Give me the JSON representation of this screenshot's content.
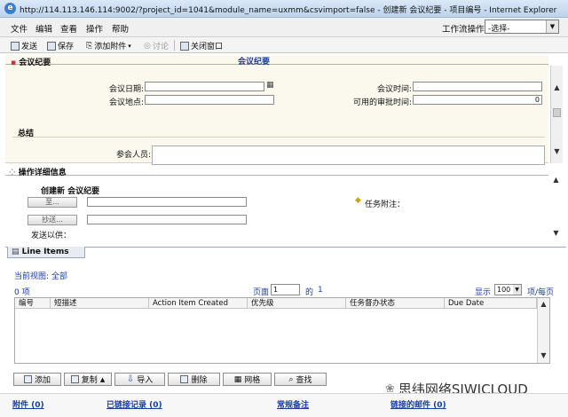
{
  "window": {
    "title": "http://114.113.146.114:9002/?project_id=1041&module_name=uxmm&csvimport=false - 创建新 会议纪要 - 项目编号 - Internet Explorer"
  },
  "menu": [
    "文件",
    "编辑",
    "查看",
    "操作",
    "帮助"
  ],
  "workflow": {
    "label": "工作流操作",
    "selected": "-选择-"
  },
  "toolbar": {
    "send": "发送",
    "save": "保存",
    "attach": "添加附件",
    "discuss": "讨论",
    "close": "关闭窗口"
  },
  "meeting": {
    "section_label": "会议纪要",
    "tab_title": "会议纪要",
    "date_label": "会议日期:",
    "time_label": "会议时间:",
    "place_label": "会议地点:",
    "approve_time_label": "可用的审批时间:",
    "approve_time_value": "0",
    "summary_label": "总结",
    "attendees_label": "参会人员:"
  },
  "details": {
    "section_label": "操作详细信息",
    "create_title": "创建新 会议纪要",
    "to_button": "至...",
    "cc_button": "抄送...",
    "send_as": "发送以供：",
    "note_label": "任务附注："
  },
  "line_items": {
    "section_label": "Line Items",
    "view_label": "当前视图:",
    "view_value": "全部",
    "count_text": "0 项",
    "page_label": "页面",
    "page_value": "1",
    "of_label": "的",
    "total_pages": "1",
    "display_label": "显示",
    "per_page": "100",
    "per_page_suffix": "项/每页",
    "columns": [
      "编号",
      "短描述",
      "Action Item Created",
      "优先级",
      "任务督办状态",
      "Due Date"
    ]
  },
  "bottom_buttons": [
    "添加",
    "复制",
    "导入",
    "删除",
    "网格",
    "查找"
  ],
  "footer_links": [
    "附件 (0)",
    "已链接记录 (0)",
    "常规备注",
    "链接的邮件 (0)"
  ],
  "watermark": "思纬网络SIWICLOUD"
}
